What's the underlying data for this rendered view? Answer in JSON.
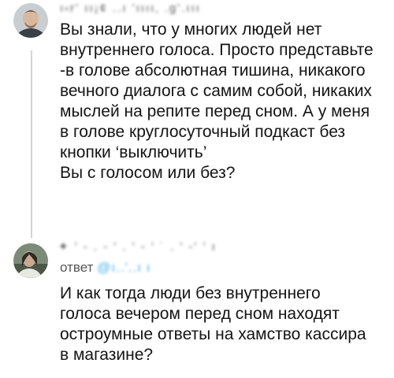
{
  "tweet1": {
    "author": "ı‹r' ıı¡¢ ..ı 'ıııı‚ .g'.ııı",
    "text_lines": [
      "Вы знали, что у многих людей нет",
      "внутреннего голоса. Просто представьте",
      "-в голове абсолютная тишина, никакого",
      "вечного диалога с самим собой, никаких",
      "мыслей на репите перед сном. А у меня",
      "в голове круглосуточный подкаст без",
      "кнопки ‘выключить’",
      "Вы с голосом или без?"
    ]
  },
  "tweet2": {
    "author": "✦ '  -  . - ' . '  - ' ˙ .  ' -'  ' ı",
    "reply_prefix": "ответ",
    "reply_handle": "@ı..'..ı  ı",
    "text_lines": [
      "И как тогда люди без внутреннего",
      "голоса вечером перед сном находят",
      "остроумные ответы на хамство кассира",
      "в магазине?"
    ]
  },
  "colors": {
    "text": "#141414",
    "thread_line": "#cfd5da",
    "link": "#1d9bf0"
  }
}
